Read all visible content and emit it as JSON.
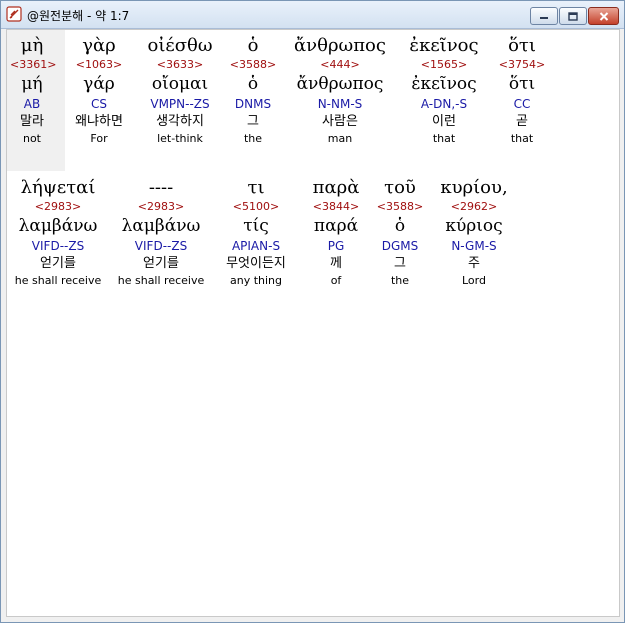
{
  "window": {
    "title": "@원전분해 - 약 1:7",
    "icon": "feather-pen-icon"
  },
  "rows": [
    {
      "words": [
        {
          "greek": "μὴ",
          "strong": "<3361>",
          "lemma": "μή",
          "morph": "AB",
          "korean": "말라",
          "english": "not"
        },
        {
          "greek": "γὰρ",
          "strong": "<1063>",
          "lemma": "γάρ",
          "morph": "CS",
          "korean": "왜냐하면",
          "english": "For"
        },
        {
          "greek": "οἰέσθω",
          "strong": "<3633>",
          "lemma": "οἴομαι",
          "morph": "VMPN--ZS",
          "korean": "생각하지",
          "english": "let-think"
        },
        {
          "greek": "ὁ",
          "strong": "<3588>",
          "lemma": "ὁ",
          "morph": "DNMS",
          "korean": "그",
          "english": "the"
        },
        {
          "greek": "ἄνθρωπος",
          "strong": "<444>",
          "lemma": "ἄνθρωπος",
          "morph": "N-NM-S",
          "korean": "사람은",
          "english": "man"
        },
        {
          "greek": "ἐκεῖνος",
          "strong": "<1565>",
          "lemma": "ἐκεῖνος",
          "morph": "A-DN,-S",
          "korean": "이런",
          "english": "that"
        },
        {
          "greek": "ὅτι",
          "strong": "<3754>",
          "lemma": "ὅτι",
          "morph": "CC",
          "korean": "곧",
          "english": "that"
        }
      ]
    },
    {
      "words": [
        {
          "greek": "λήψεταί",
          "strong": "<2983>",
          "lemma": "λαμβάνω",
          "morph": "VIFD--ZS",
          "korean": "얻기를",
          "english": "he shall receive"
        },
        {
          "greek": "----",
          "strong": "<2983>",
          "lemma": "λαμβάνω",
          "morph": "VIFD--ZS",
          "korean": "얻기를",
          "english": "he shall receive"
        },
        {
          "greek": "τι",
          "strong": "<5100>",
          "lemma": "τίς",
          "morph": "APIAN-S",
          "korean": "무엇이든지",
          "english": "any thing"
        },
        {
          "greek": "παρὰ",
          "strong": "<3844>",
          "lemma": "παρά",
          "morph": "PG",
          "korean": "께",
          "english": "of"
        },
        {
          "greek": "τοῦ",
          "strong": "<3588>",
          "lemma": "ὁ",
          "morph": "DGMS",
          "korean": "그",
          "english": "the"
        },
        {
          "greek": "κυρίου,",
          "strong": "<2962>",
          "lemma": "κύριος",
          "morph": "N-GM-S",
          "korean": "주",
          "english": "Lord"
        }
      ]
    }
  ]
}
